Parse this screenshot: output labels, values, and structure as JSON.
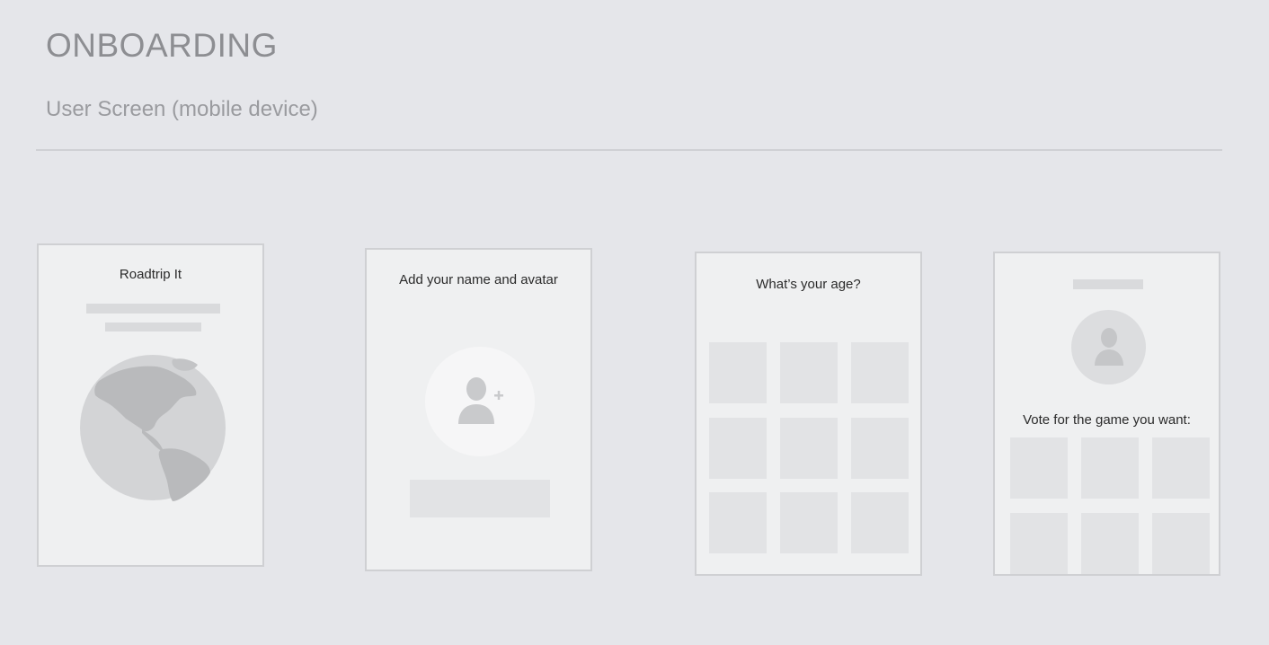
{
  "header": {
    "title": "ONBOARDING",
    "subtitle": "User Screen (mobile device)"
  },
  "screens": [
    {
      "title": "Roadtrip It",
      "icon": "globe-icon"
    },
    {
      "title": "Add your name and avatar",
      "icon": "add-user-icon"
    },
    {
      "title": "What’s your age?",
      "icon": "grid-tiles"
    },
    {
      "title": "Vote for the game you want:",
      "icon": "user-icon"
    }
  ],
  "colors": {
    "background": "#e5e6ea",
    "card": "#eff0f1",
    "placeholder": "#d9dadc",
    "tile": "#e2e3e5"
  }
}
